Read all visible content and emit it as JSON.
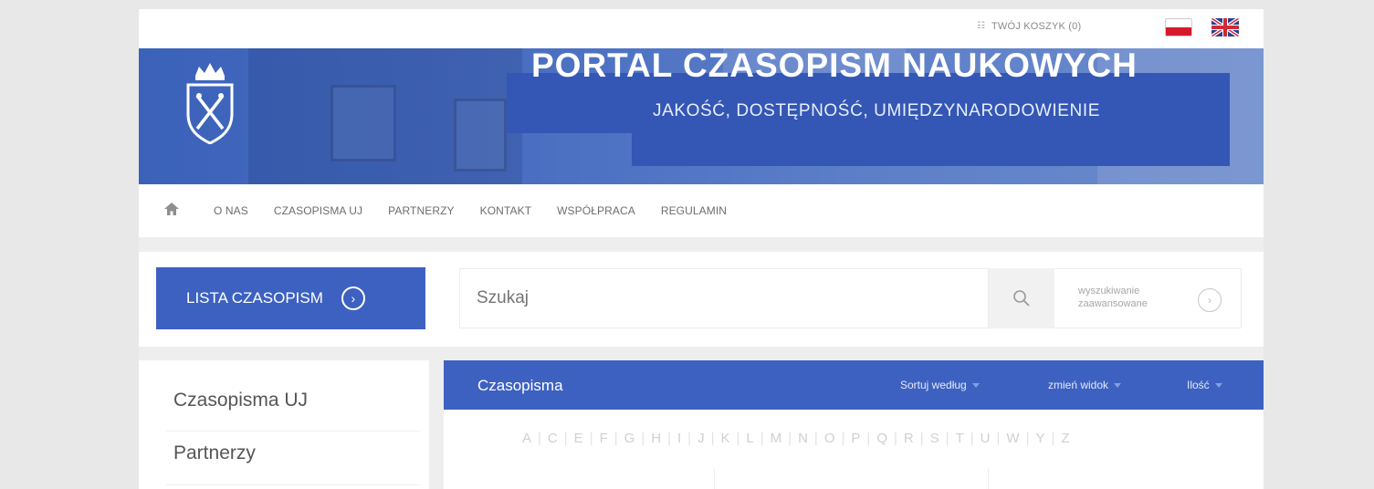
{
  "topbar": {
    "cart_label": "TWÓJ KOSZYK (0)",
    "cart_icon": "cart-icon",
    "lang_pl_icon": "flag-pl-icon",
    "lang_en_icon": "flag-en-icon"
  },
  "banner": {
    "title": "PORTAL CZASOPISM NAUKOWYCH",
    "subtitle": "JAKOŚĆ, DOSTĘPNOŚĆ, UMIĘDZYNARODOWIENIE",
    "logo_icon": "crest-icon"
  },
  "nav": {
    "home_icon": "home-icon",
    "items": [
      "O NAS",
      "CZASOPISMA UJ",
      "PARTNERZY",
      "KONTAKT",
      "WSPÓŁPRACA",
      "REGULAMIN"
    ]
  },
  "search": {
    "list_button": "LISTA CZASOPISM",
    "placeholder": "Szukaj",
    "advanced_line1": "wyszukiwanie",
    "advanced_line2": "zaawansowane"
  },
  "sidebar": {
    "items": [
      "Czasopisma UJ",
      "Partnerzy"
    ]
  },
  "content": {
    "title": "Czasopisma",
    "sort_label": "Sortuj według",
    "view_label": "zmień widok",
    "count_label": "Ilość",
    "alphabet": [
      "A",
      "C",
      "E",
      "F",
      "G",
      "H",
      "I",
      "J",
      "K",
      "L",
      "M",
      "N",
      "O",
      "P",
      "Q",
      "R",
      "S",
      "T",
      "U",
      "W",
      "Y",
      "Z"
    ]
  },
  "colors": {
    "brand_blue": "#3d61c0",
    "banner_blue": "#3457b6",
    "page_bg": "#e9e8e8"
  }
}
